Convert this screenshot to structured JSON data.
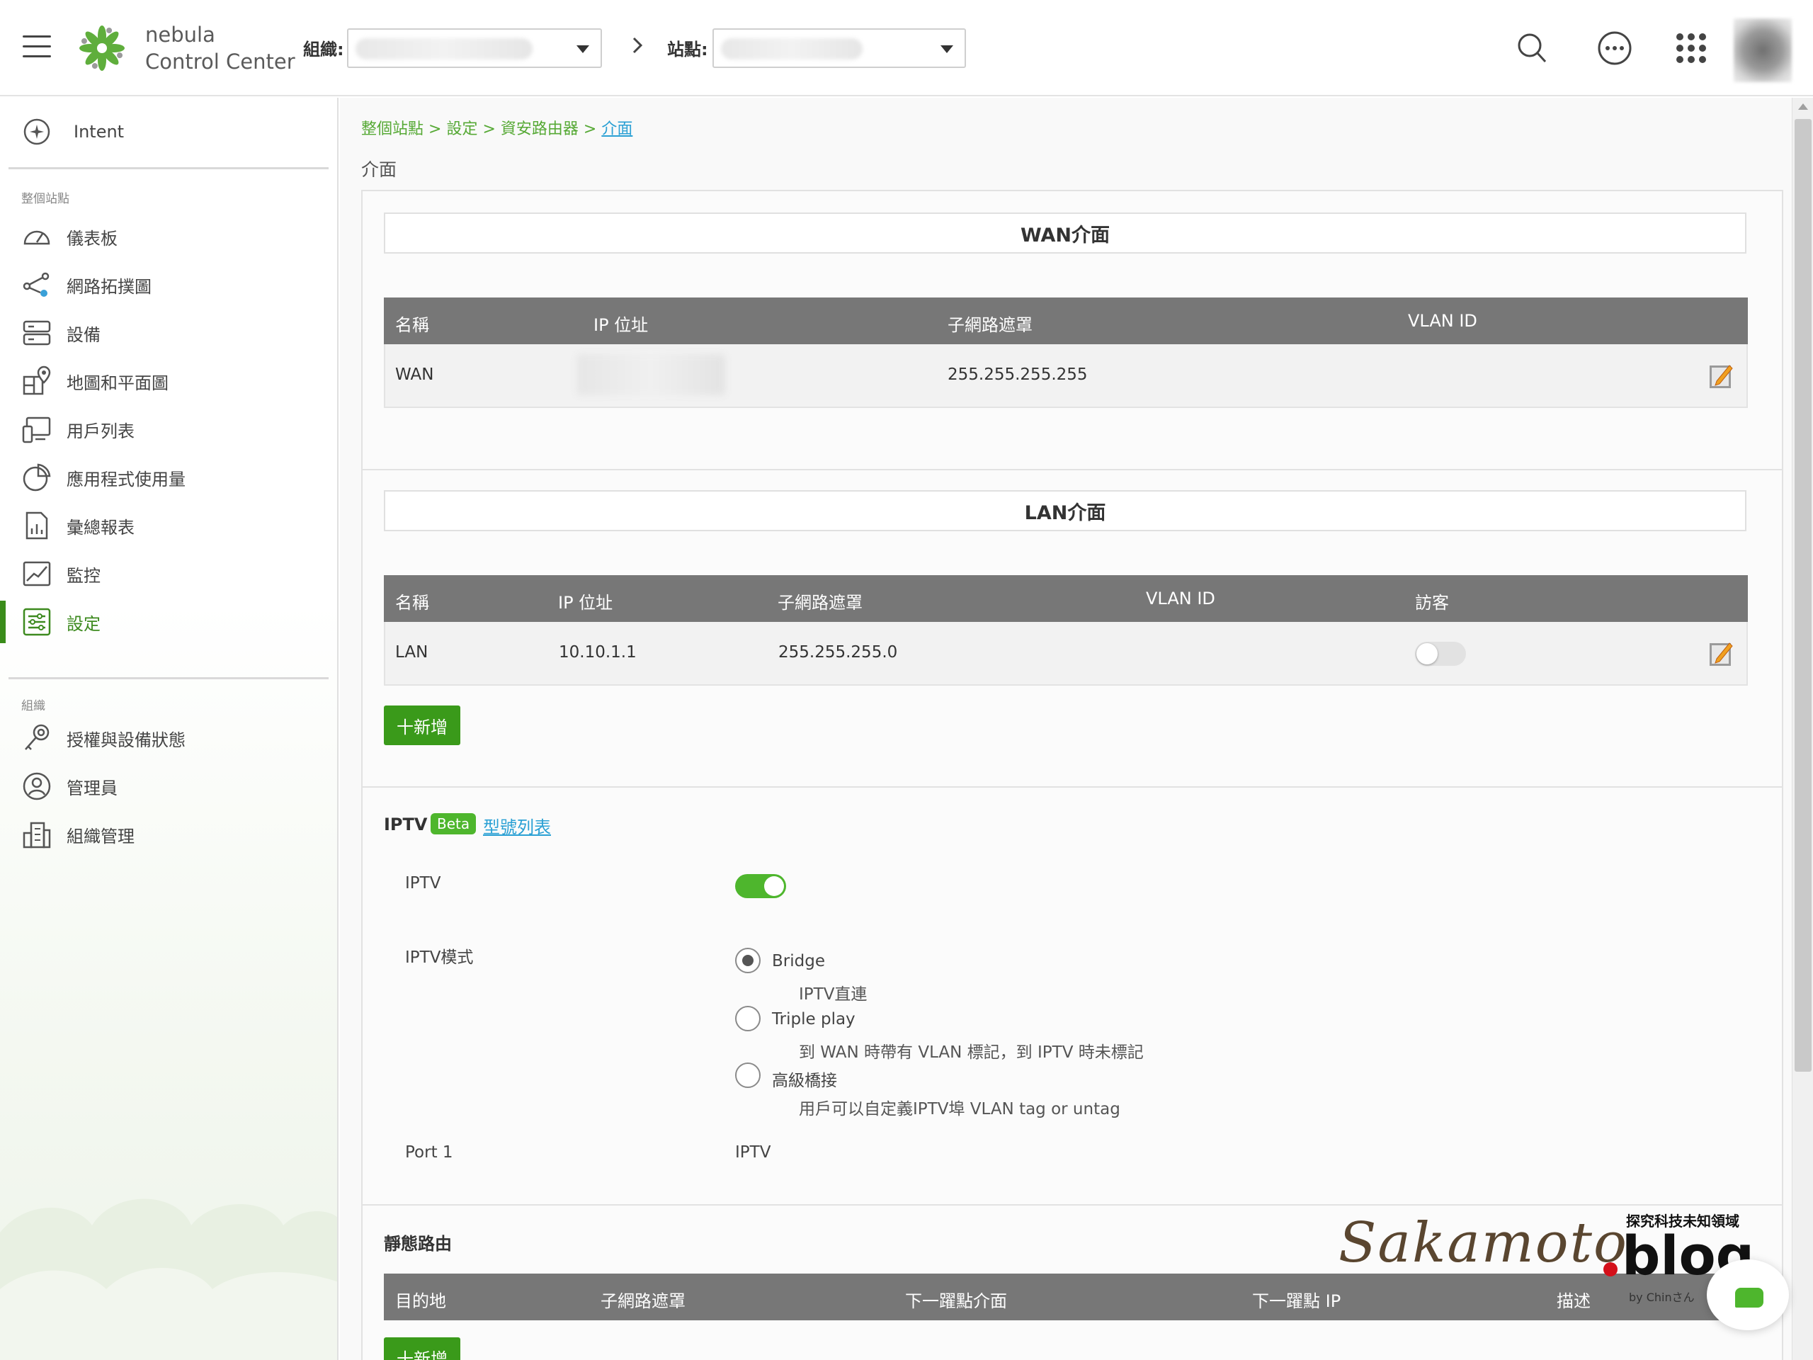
{
  "header": {
    "brand_line1": "nebula",
    "brand_line2": "Control Center",
    "org_label": "組織:",
    "site_label": "站點:"
  },
  "sidebar": {
    "intent": "Intent",
    "section_site": "整個站點",
    "items": [
      {
        "label": "儀表板",
        "icon": "dashboard-icon"
      },
      {
        "label": "網路拓撲圖",
        "icon": "topology-icon"
      },
      {
        "label": "設備",
        "icon": "devices-icon"
      },
      {
        "label": "地圖和平面圖",
        "icon": "map-icon"
      },
      {
        "label": "用戶列表",
        "icon": "clients-icon"
      },
      {
        "label": "應用程式使用量",
        "icon": "pie-chart-icon"
      },
      {
        "label": "彙總報表",
        "icon": "report-icon"
      },
      {
        "label": "監控",
        "icon": "monitor-icon"
      },
      {
        "label": "設定",
        "icon": "settings-icon",
        "active": true
      }
    ],
    "section_org": "組織",
    "org_items": [
      {
        "label": "授權與設備狀態",
        "icon": "license-icon"
      },
      {
        "label": "管理員",
        "icon": "admin-icon"
      },
      {
        "label": "組織管理",
        "icon": "org-building-icon"
      }
    ]
  },
  "breadcrumb": {
    "p1": "整個站點",
    "p2": "設定",
    "p3": "資安路由器",
    "current": "介面",
    "sep": ">"
  },
  "page_title": "介面",
  "wan": {
    "title": "WAN介面",
    "columns": [
      "名稱",
      "IP 位址",
      "子網路遮罩",
      "VLAN ID"
    ],
    "row": {
      "name": "WAN",
      "subnet": "255.255.255.255"
    }
  },
  "lan": {
    "title": "LAN介面",
    "columns": [
      "名稱",
      "IP 位址",
      "子網路遮罩",
      "VLAN ID",
      "訪客"
    ],
    "row": {
      "name": "LAN",
      "ip": "10.10.1.1",
      "subnet": "255.255.255.0"
    },
    "add_button": "十新增"
  },
  "iptv": {
    "title": "IPTV",
    "beta": "Beta",
    "model_link": "型號列表",
    "iptv_label": "IPTV",
    "mode_label": "IPTV模式",
    "options": [
      {
        "label": "Bridge",
        "desc": "IPTV直連",
        "selected": true
      },
      {
        "label": "Triple play",
        "desc": "到 WAN 時帶有 VLAN 標記，到 IPTV 時未標記",
        "selected": false
      },
      {
        "label": "高級橋接",
        "desc": "用戶可以自定義IPTV埠 VLAN tag or untag",
        "selected": false
      }
    ],
    "port_label": "Port 1",
    "port_value": "IPTV"
  },
  "static_route": {
    "title": "靜態路由",
    "columns": [
      "目的地",
      "子網路遮罩",
      "下一躍點介面",
      "下一躍點 IP",
      "描述"
    ],
    "add_button": "十新增"
  },
  "watermark": {
    "script": "Sakamoto",
    "blog": "blog",
    "tagline": "探究科技未知領域",
    "by": "by Chinさん"
  }
}
